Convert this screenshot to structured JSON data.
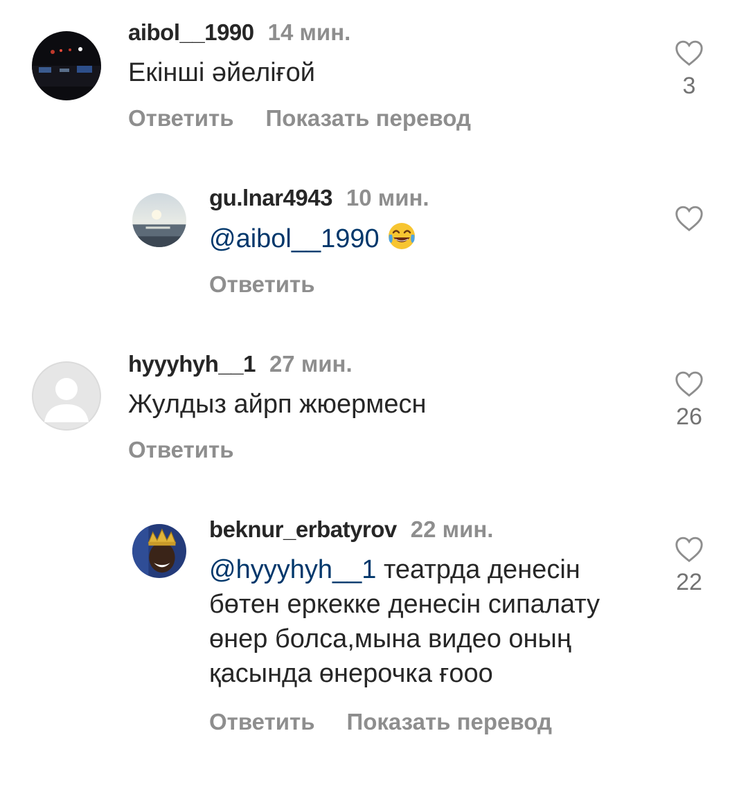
{
  "comments": [
    {
      "username": "aibol__1990",
      "time": "14 мин.",
      "text": "Екінші әйеліғой",
      "actions": [
        "Ответить",
        "Показать перевод"
      ],
      "likes": "3",
      "avatar": "night-city-avatar"
    },
    {
      "username": "gu.lnar4943",
      "time": "10 мин.",
      "mention": "@aibol__1990",
      "text": "",
      "emoji": "face-with-tears-of-joy-icon",
      "actions": [
        "Ответить"
      ],
      "likes": "",
      "avatar": "sunset-sea-avatar"
    },
    {
      "username": "hyyyhyh__1",
      "time": "27 мин.",
      "text": "Жулдыз айрп жюермесн",
      "actions": [
        "Ответить"
      ],
      "likes": "26",
      "avatar": "default-user-avatar"
    },
    {
      "username": "beknur_erbatyrov",
      "time": "22 мин.",
      "mention": "@hyyyhyh__1",
      "text": " театрда денесін бөтен еркекке денесін сипалату өнер болса,мына видео оның қасында өнерочка ғооо",
      "actions": [
        "Ответить",
        "Показать перевод"
      ],
      "likes": "22",
      "avatar": "crowned-man-avatar"
    }
  ],
  "colors": {
    "text": "#262626",
    "secondary": "#8e8e8e",
    "mention": "#00376b"
  }
}
